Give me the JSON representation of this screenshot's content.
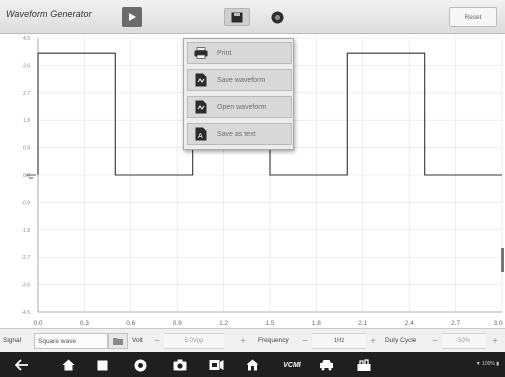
{
  "toolbar": {
    "title": "Waveform Generator",
    "play_icon": "play-icon",
    "save_icon": "save-icon",
    "help_icon": "help-icon",
    "reset_label": "Reset"
  },
  "menu": {
    "items": [
      {
        "label": "Print",
        "icon": "print-icon"
      },
      {
        "label": "Save waveform",
        "icon": "save-waveform-icon"
      },
      {
        "label": "Open waveform",
        "icon": "open-waveform-icon"
      },
      {
        "label": "Save as text",
        "icon": "save-as-text-icon"
      }
    ]
  },
  "chart_data": {
    "type": "line",
    "x_ticks": [
      "0.0",
      "0.3",
      "0.6",
      "0.9",
      "1.2",
      "1.5",
      "1.8",
      "2.1",
      "2.4",
      "2.7",
      "3.0"
    ],
    "y_ticks": [
      "4.5",
      "3.6",
      "2.7",
      "1.8",
      "0.9",
      "0.0",
      "-0.9",
      "-1.8",
      "-2.7",
      "-3.6",
      "-4.5"
    ],
    "xlim": [
      0,
      3.0
    ],
    "ylim": [
      -4.5,
      4.5
    ],
    "series": [
      {
        "x": [
          0.0,
          0.0,
          0.5,
          0.5,
          1.0,
          1.0,
          1.5,
          1.5,
          2.0,
          2.0,
          2.5,
          2.5,
          3.0
        ],
        "y": [
          0.0,
          4.0,
          4.0,
          0.0,
          0.0,
          4.0,
          4.0,
          0.0,
          0.0,
          4.0,
          4.0,
          0.0,
          0.0
        ]
      }
    ],
    "grid": true
  },
  "controls": {
    "signal_label": "Signal",
    "signal_value": "Square wave",
    "volt_label": "Volt",
    "volt_value": "5.0Vpp",
    "frequency_label": "Frequency",
    "frequency_value": "1Hz",
    "duty_label": "Duty Cycle",
    "duty_value": "50%",
    "minus": "−",
    "plus": "+"
  },
  "navbar": {
    "status_text": "▼ 100% ▮",
    "vcmi_label": "VCMI"
  },
  "colors": {
    "trace": "#333333",
    "grid": "#e3e3e3",
    "toolbar_bg": "#e6e6e6",
    "menu_bg": "#ececec",
    "navbar_bg": "#1f1f1f"
  }
}
